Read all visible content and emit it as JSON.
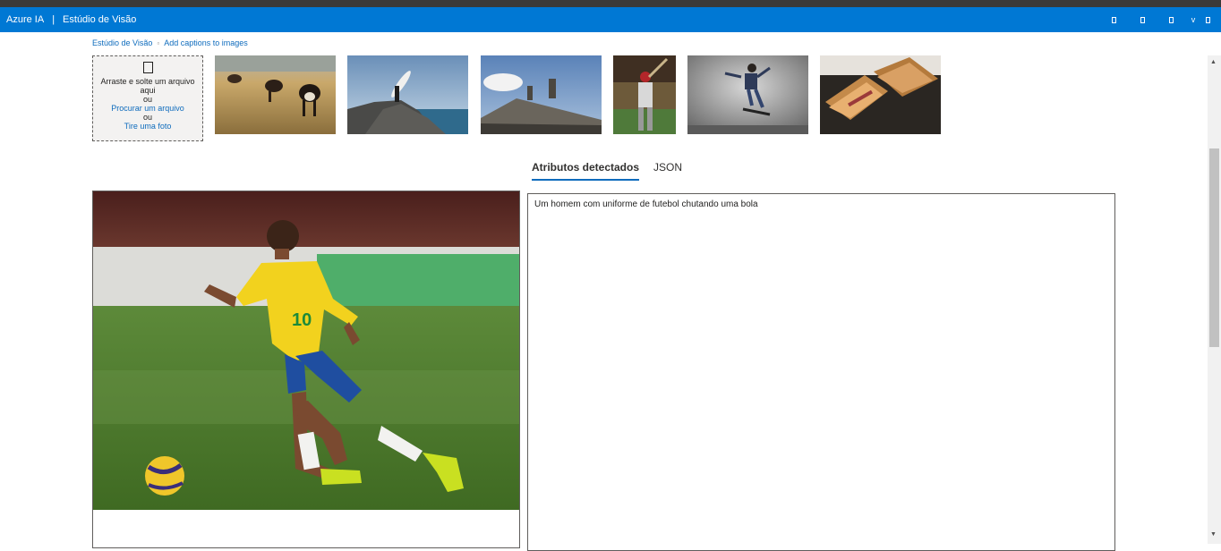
{
  "app": {
    "brand": "Azure IA",
    "separator": "|",
    "title": "Estúdio de Visão"
  },
  "appbar_icons": [
    "window-icon",
    "window-icon",
    "window-icon",
    "chevron-down-icon",
    "window-icon"
  ],
  "breadcrumb": {
    "root": "Estúdio de Visão",
    "current": "Add captions to images"
  },
  "dropzone": {
    "line1": "Arraste e solte um arquivo aqui",
    "or1": "ou",
    "browse": "Procurar um arquivo",
    "or2": "ou",
    "photo": "Tire uma foto"
  },
  "samples": [
    {
      "name": "cows-in-field"
    },
    {
      "name": "surfer-on-rock"
    },
    {
      "name": "building-statues"
    },
    {
      "name": "baseball-batter"
    },
    {
      "name": "skateboarder"
    },
    {
      "name": "grilled-sandwich"
    }
  ],
  "tabs": {
    "attributes": "Atributos detectados",
    "json": "JSON"
  },
  "result": {
    "caption": "Um homem com uniforme de futebol chutando uma bola"
  },
  "colors": {
    "accent": "#0078d4",
    "link": "#0f6cbd"
  }
}
